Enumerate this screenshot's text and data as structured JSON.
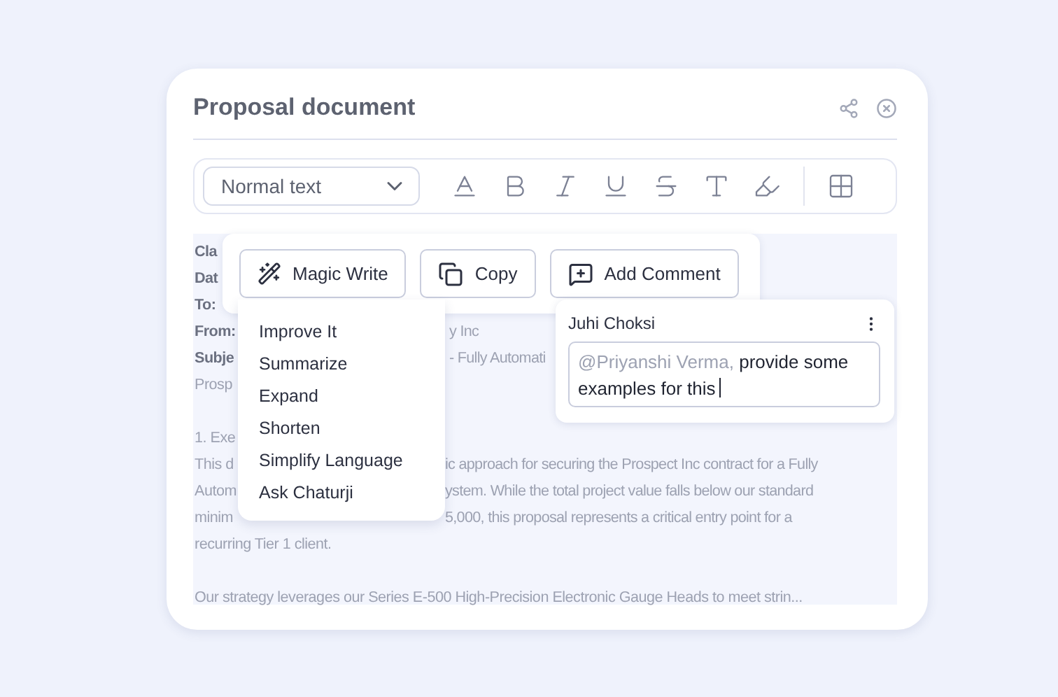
{
  "title": "Proposal document",
  "toolbar": {
    "style_select": "Normal text"
  },
  "document": {
    "lines": [
      {
        "kind": "label",
        "left": "Cla"
      },
      {
        "kind": "label",
        "left": "Dat"
      },
      {
        "kind": "label",
        "left": "To:"
      },
      {
        "kind": "label",
        "left": "From:",
        "right": "y Inc"
      },
      {
        "kind": "label",
        "left": "Subje",
        "right": "- Fully Automati"
      },
      {
        "kind": "body",
        "left": "Prosp"
      },
      {
        "kind": "gap"
      },
      {
        "kind": "body",
        "left": "1. Exe"
      },
      {
        "kind": "body",
        "left": "This d",
        "right": "ic approach for securing the Prospect Inc contract for a Fully"
      },
      {
        "kind": "body",
        "left": "Autom",
        "right": "ystem. While the total project value falls below our standard"
      },
      {
        "kind": "body",
        "left": "minim",
        "right": "5,000, this proposal represents a critical entry point for a"
      },
      {
        "kind": "body",
        "left": "recurring Tier 1 client."
      },
      {
        "kind": "gap"
      },
      {
        "kind": "body",
        "left": "Our strategy leverages our Series E-500 High-Precision Electronic Gauge Heads to meet strin..."
      }
    ]
  },
  "selection_actions": [
    {
      "kind": "magic",
      "label": "Magic Write"
    },
    {
      "kind": "copy",
      "label": "Copy"
    },
    {
      "kind": "comment",
      "label": "Add Comment"
    }
  ],
  "magic_menu": [
    "Improve It",
    "Summarize",
    "Expand",
    "Shorten",
    "Simplify Language",
    "Ask Chaturji"
  ],
  "comment": {
    "author": "Juhi Choksi",
    "mention": "@Priyanshi Verma,",
    "text": "provide some examples for this"
  }
}
